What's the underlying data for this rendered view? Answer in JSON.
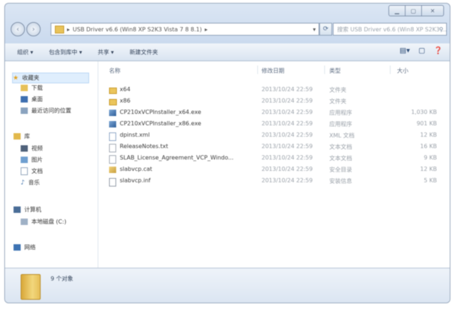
{
  "window": {
    "caption_buttons": [
      "minimize-icon",
      "maximize-icon",
      "close-icon"
    ]
  },
  "address_bar": {
    "path": "USB Driver v6.6 (Win8 XP S2K3 Vista 7 8 8.1)",
    "search_placeholder": "搜索 USB Driver v6.6 (Win8 XP S2K3 ..."
  },
  "toolbar": {
    "organize": "组织 ▾",
    "include_in_library": "包含到库中 ▾",
    "share": "共享 ▾",
    "new_folder": "新建文件夹"
  },
  "sidebar": {
    "favorites": {
      "label": "收藏夹",
      "items": [
        "下载",
        "桌面",
        "最近访问的位置"
      ]
    },
    "libraries": {
      "label": "库",
      "items": [
        "视频",
        "图片",
        "文档",
        "音乐"
      ]
    },
    "computer": {
      "label": "计算机",
      "items": [
        "本地磁盘 (C:)"
      ]
    },
    "network": {
      "label": "网络"
    }
  },
  "file_list": {
    "columns": {
      "name": "名称",
      "date": "修改日期",
      "type": "类型",
      "size": "大小"
    },
    "rows": [
      {
        "name": "x64",
        "date": "2013/10/24 22:59",
        "type": "文件夹",
        "size": "",
        "icon": "folder-icon"
      },
      {
        "name": "x86",
        "date": "2013/10/24 22:59",
        "type": "文件夹",
        "size": "",
        "icon": "folder-icon"
      },
      {
        "name": "CP210xVCPInstaller_x64.exe",
        "date": "2013/10/24 22:59",
        "type": "应用程序",
        "size": "1,030 KB",
        "icon": "exe-icon"
      },
      {
        "name": "CP210xVCPInstaller_x86.exe",
        "date": "2013/10/24 22:59",
        "type": "应用程序",
        "size": "901 KB",
        "icon": "exe-icon"
      },
      {
        "name": "dpinst.xml",
        "date": "2013/10/24 22:59",
        "type": "XML 文档",
        "size": "12 KB",
        "icon": "xml-icon"
      },
      {
        "name": "ReleaseNotes.txt",
        "date": "2013/10/24 22:59",
        "type": "文本文档",
        "size": "16 KB",
        "icon": "txt-icon"
      },
      {
        "name": "SLAB_License_Agreement_VCP_Windo...",
        "date": "2013/10/24 22:59",
        "type": "文本文档",
        "size": "9 KB",
        "icon": "txt-icon"
      },
      {
        "name": "slabvcp.cat",
        "date": "2013/10/24 22:59",
        "type": "安全目录",
        "size": "12 KB",
        "icon": "catalog-icon"
      },
      {
        "name": "slabvcp.inf",
        "date": "2013/10/24 22:59",
        "type": "安装信息",
        "size": "5 KB",
        "icon": "inf-icon"
      }
    ]
  },
  "details_pane": {
    "item_count": "9 个对象"
  }
}
